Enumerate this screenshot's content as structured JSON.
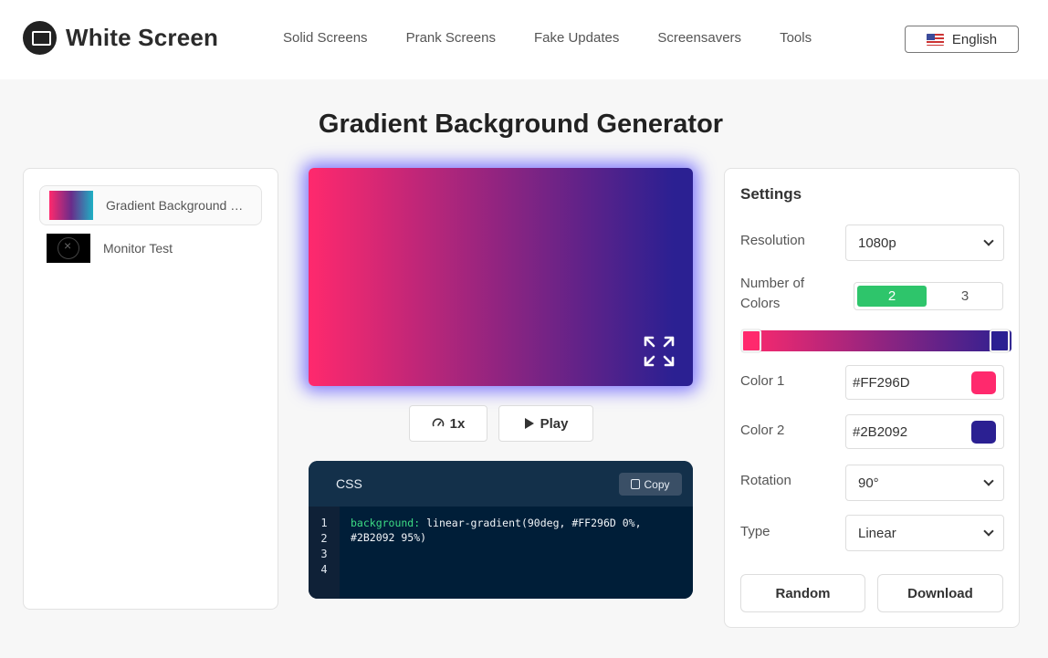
{
  "header": {
    "logo_text": "White Screen",
    "nav": [
      "Solid Screens",
      "Prank Screens",
      "Fake Updates",
      "Screensavers",
      "Tools"
    ],
    "language": "English"
  },
  "page_title": "Gradient Background Generator",
  "tools": [
    {
      "label": "Gradient Background Generator",
      "active": true
    },
    {
      "label": "Monitor Test",
      "active": false
    }
  ],
  "preview": {
    "color1": "#FF296D",
    "color2": "#2B2092",
    "rotation_deg": 90,
    "speed_label": "1x",
    "play_label": "Play"
  },
  "code": {
    "lang": "CSS",
    "copy_label": "Copy",
    "line_numbers": [
      "1",
      "2",
      "3",
      "4"
    ],
    "property": "background:",
    "value": " linear-gradient(90deg, #FF296D 0%, #2B2092 95%)"
  },
  "settings": {
    "title": "Settings",
    "resolution_label": "Resolution",
    "resolution_value": "1080p",
    "num_colors_label": "Number of Colors",
    "num_colors_options": [
      "2",
      "3"
    ],
    "num_colors_selected": "2",
    "color1_label": "Color 1",
    "color1_value": "#FF296D",
    "color2_label": "Color 2",
    "color2_value": "#2B2092",
    "rotation_label": "Rotation",
    "rotation_value": "90°",
    "type_label": "Type",
    "type_value": "Linear",
    "random_label": "Random",
    "download_label": "Download"
  },
  "colors": {
    "accent_green": "#2ec56b",
    "glow": "#463cff",
    "code_bg": "#001e38"
  }
}
